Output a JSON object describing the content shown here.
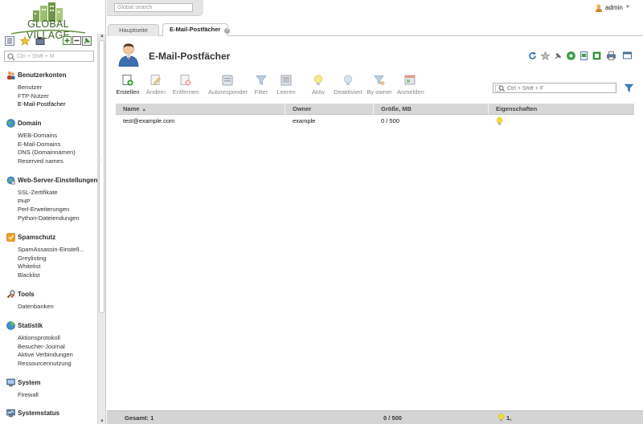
{
  "logo": {
    "text": "GLOBAL VILLAGE"
  },
  "left_search": {
    "placeholder": "Ctrl + Shift + M"
  },
  "global_search": {
    "placeholder": "Global search"
  },
  "user": {
    "name": "admin"
  },
  "tabs": [
    {
      "label": "Hauptseite",
      "active": false
    },
    {
      "label": "E-Mail-Postfächer",
      "active": true
    }
  ],
  "nav": {
    "groups": [
      {
        "id": "benutzerkonten",
        "title": "Benutzerkonten",
        "icon": "users-icon",
        "items": [
          "Benutzer",
          "FTP-Nutzer",
          "E-Mail-Postfächer"
        ]
      },
      {
        "id": "domain",
        "title": "Domain",
        "icon": "globe-icon",
        "items": [
          "WEB-Domains",
          "E-Mail-Domains",
          "DNS (Domainnamen)",
          "Reserved names"
        ]
      },
      {
        "id": "webserver",
        "title": "Web-Server-Einstellungen",
        "icon": "webserver-icon",
        "items": [
          "SSL-Zertifikate",
          "PHP",
          "Perl-Erweiterungen",
          "Python-Dateiendungen"
        ]
      },
      {
        "id": "spamschutz",
        "title": "Spamschutz",
        "icon": "shield-icon",
        "items": [
          "SpamAssassin-Einstell...",
          "Greylisting",
          "Whitelist",
          "Blacklist"
        ]
      },
      {
        "id": "tools",
        "title": "Tools",
        "icon": "tools-icon",
        "items": [
          "Datenbanken"
        ]
      },
      {
        "id": "statistik",
        "title": "Statistik",
        "icon": "statistics-icon",
        "items": [
          "Aktionsprotokoll",
          "Besucher-Journal",
          "Aktive Verbindungen",
          "Ressourcennutzung"
        ]
      },
      {
        "id": "system",
        "title": "System",
        "icon": "system-icon",
        "items": [
          "Firewall"
        ]
      },
      {
        "id": "systemstatus",
        "title": "Systemstatus",
        "icon": "monitor-icon",
        "items": []
      }
    ]
  },
  "page": {
    "title": "E-Mail-Postfächer"
  },
  "toolbar": {
    "buttons": [
      {
        "id": "erstellen",
        "label": "Erstellen",
        "icon": "create-icon",
        "enabled": true
      },
      {
        "id": "aendern",
        "label": "Ändern",
        "icon": "edit-icon",
        "enabled": false
      },
      {
        "id": "entfernen",
        "label": "Entfernen",
        "icon": "delete-icon",
        "enabled": false
      },
      {
        "id": "autoresponder",
        "label": "Autoresponder",
        "icon": "autoresponder-icon",
        "enabled": false
      },
      {
        "id": "filter",
        "label": "Filter",
        "icon": "filter-icon",
        "enabled": false
      },
      {
        "id": "leeren",
        "label": "Leeren",
        "icon": "clear-icon",
        "enabled": false
      },
      {
        "id": "aktiv",
        "label": "Aktiv",
        "icon": "bulb-on-icon",
        "enabled": false
      },
      {
        "id": "deaktiviert",
        "label": "Deaktiviert",
        "icon": "bulb-off-icon",
        "enabled": false
      },
      {
        "id": "byowner",
        "label": "By owner",
        "icon": "by-owner-icon",
        "enabled": false
      },
      {
        "id": "anmelden",
        "label": "Anmelden",
        "icon": "login-icon",
        "enabled": false
      }
    ]
  },
  "table_search": {
    "placeholder": "Ctrl + Shift + F"
  },
  "table": {
    "columns": [
      "Name",
      "Owner",
      "Größe, MB",
      "Eigenschaften"
    ],
    "sort_column": "Name",
    "rows": [
      {
        "name": "test@example.com",
        "owner": "example",
        "size": "0 / 500",
        "properties_icon": "bulb-on-icon"
      }
    ]
  },
  "footer": {
    "total": "Gesamt: 1",
    "size_total": "0 / 500",
    "active_count": "1,"
  },
  "colors": {
    "header_bg": "#d7d7d7",
    "footer_bg": "#d4d4d4",
    "tab_inactive": "#e8e8e8",
    "logo_green": "#3c5e2a"
  }
}
